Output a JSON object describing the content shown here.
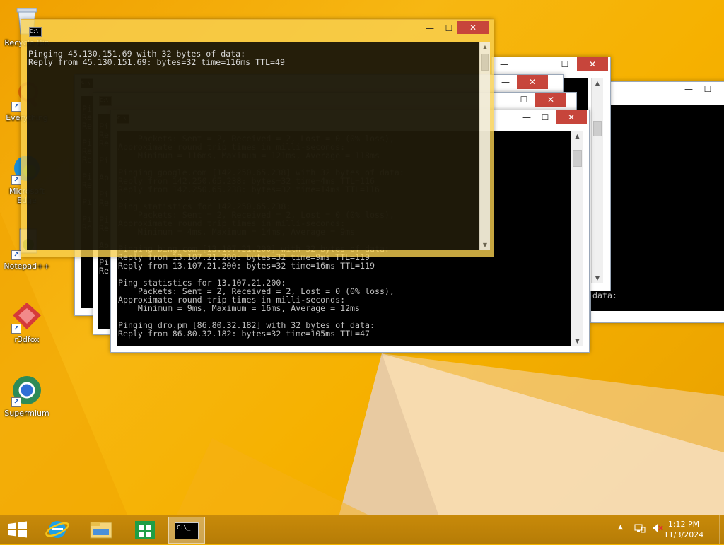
{
  "desktop_icons": [
    {
      "label": "Recycle Bin",
      "icon": "recycle-bin-icon"
    },
    {
      "label": "Everything",
      "icon": "everything-icon"
    },
    {
      "label": "Microsoft Edge",
      "icon": "edge-icon"
    },
    {
      "label": "Notepad++",
      "icon": "notepad-plus-plus-icon"
    },
    {
      "label": "r3dfox",
      "icon": "r3dfox-icon"
    },
    {
      "label": "Supermium",
      "icon": "supermium-icon"
    }
  ],
  "console_front": {
    "lines": [
      "Pinging 45.130.151.69 with 32 bytes of data:",
      "Reply from 45.130.151.69: bytes=32 time=116ms TTL=49"
    ]
  },
  "console_main": {
    "lines": [
      "    Packets: Sent = 2, Received = 2, Lost = 0 (0% loss),",
      "Approximate round trip times in milli-seconds:",
      "    Minimum = 116ms, Maximum = 121ms, Average = 118ms",
      "",
      "Pinging google.com [142.250.65.238] with 32 bytes of data:",
      "Reply from 142.250.65.238: bytes=32 time=4ms TTL=116",
      "Reply from 142.250.65.238: bytes=32 time=14ms TTL=116",
      "",
      "Ping statistics for 142.250.65.238:",
      "    Packets: Sent = 2, Received = 2, Lost = 0 (0% loss),",
      "Approximate round trip times in milli-seconds:",
      "    Minimum = 4ms, Maximum = 14ms, Average = 9ms",
      "",
      "Pinging bing.com [13.107.21.200] with 32 bytes of data:",
      "Reply from 13.107.21.200: bytes=32 time=9ms TTL=119",
      "Reply from 13.107.21.200: bytes=32 time=16ms TTL=119",
      "",
      "Ping statistics for 13.107.21.200:",
      "    Packets: Sent = 2, Received = 2, Lost = 0 (0% loss),",
      "Approximate round trip times in milli-seconds:",
      "    Minimum = 9ms, Maximum = 16ms, Average = 12ms",
      "",
      "Pinging dro.pm [86.80.32.182] with 32 bytes of data:",
      "Reply from 86.80.32.182: bytes=32 time=105ms TTL=47"
    ]
  },
  "console_right": {
    "lines": [
      "data:"
    ]
  },
  "console_left_fragments": {
    "lines": [
      "Pi",
      "Re",
      "Re",
      "",
      "Pi",
      "Re",
      "Re",
      "",
      "Pi",
      "Re",
      "",
      "Pi",
      "",
      "Pi",
      "Re"
    ]
  },
  "console_left2_fragments": {
    "lines": [
      "Pi",
      "Re",
      "Re",
      "",
      "Pi",
      "",
      "Ap",
      "",
      "Pi",
      "Re",
      "",
      "Pi",
      "Re",
      "",
      "Ap",
      "",
      "Pi",
      "Re"
    ]
  },
  "window_buttons": {
    "minimize": "—",
    "maximize": "☐",
    "close": "✕"
  },
  "cmd_icon_text": "C:\\",
  "taskbar": {
    "items": [
      {
        "name": "start",
        "icon": "windows-start-icon"
      },
      {
        "name": "internet-explorer",
        "icon": "internet-explorer-icon"
      },
      {
        "name": "file-explorer",
        "icon": "file-explorer-icon"
      },
      {
        "name": "store",
        "icon": "windows-store-icon"
      },
      {
        "name": "command-prompt",
        "icon": "command-prompt-icon",
        "active": true
      }
    ],
    "cmd_taskbar_text": "C:\\_"
  },
  "tray": {
    "time": "1:12 PM",
    "date": "11/3/2024"
  },
  "colors": {
    "wallpaper": "#f4b400",
    "close_button": "#c7453b",
    "console_bg": "#000000",
    "console_fg": "#c0c0c0"
  }
}
